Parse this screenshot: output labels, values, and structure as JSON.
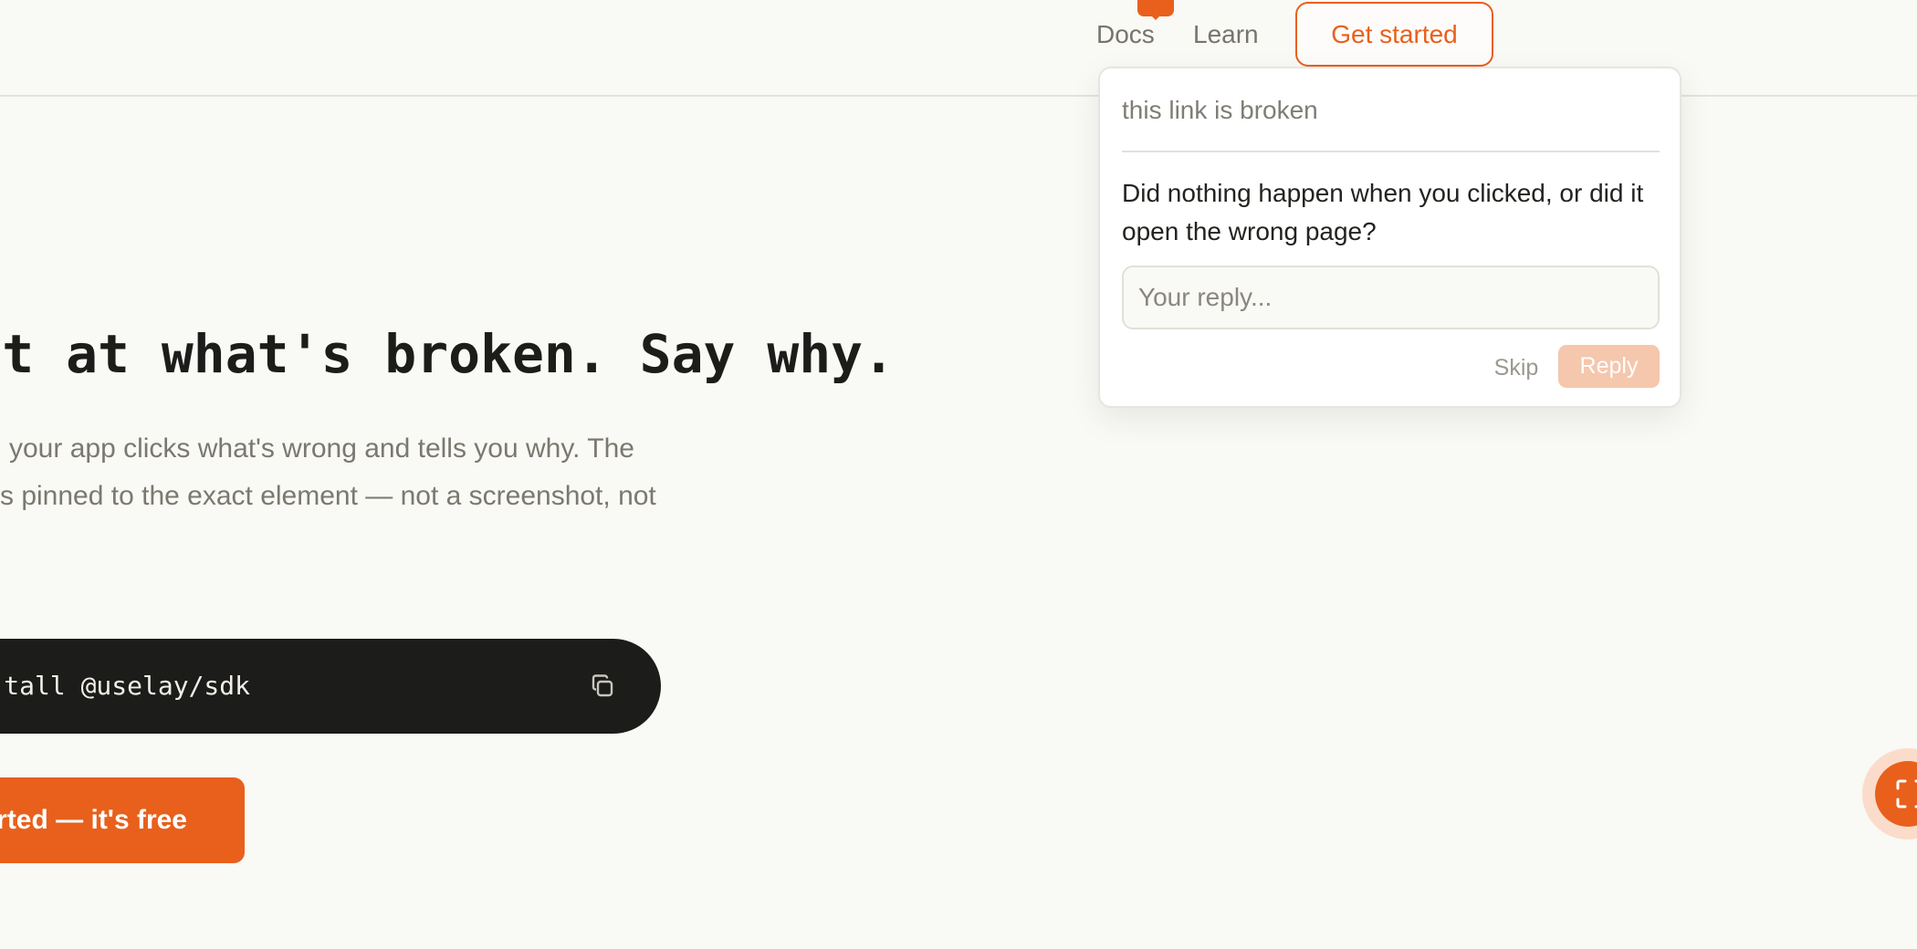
{
  "header": {
    "nav": {
      "docs_label": "Docs",
      "learn_label": "Learn"
    },
    "get_started_label": "Get started"
  },
  "hero": {
    "title": "t at what's broken. Say why.",
    "subtitle_lines": [
      "your app clicks what's wrong and tells you why. The",
      "s pinned to the exact element — not a screenshot, not"
    ],
    "install_command": "tall @uselay/sdk",
    "cta_label": "arted — it's free"
  },
  "popover": {
    "comment": "this link is broken",
    "question": "Did nothing happen when you clicked, or did it open the wrong page?",
    "reply_placeholder": "Your reply...",
    "skip_label": "Skip",
    "reply_label": "Reply"
  },
  "icons": {
    "copy": "copy-icon",
    "feedback_marker": "comment-marker-icon",
    "fab": "select-region-icon"
  },
  "colors": {
    "accent": "#e8601c",
    "background": "#f9f9f5",
    "code_background": "#1c1c1a",
    "reply_disabled": "#f5c7ad"
  }
}
